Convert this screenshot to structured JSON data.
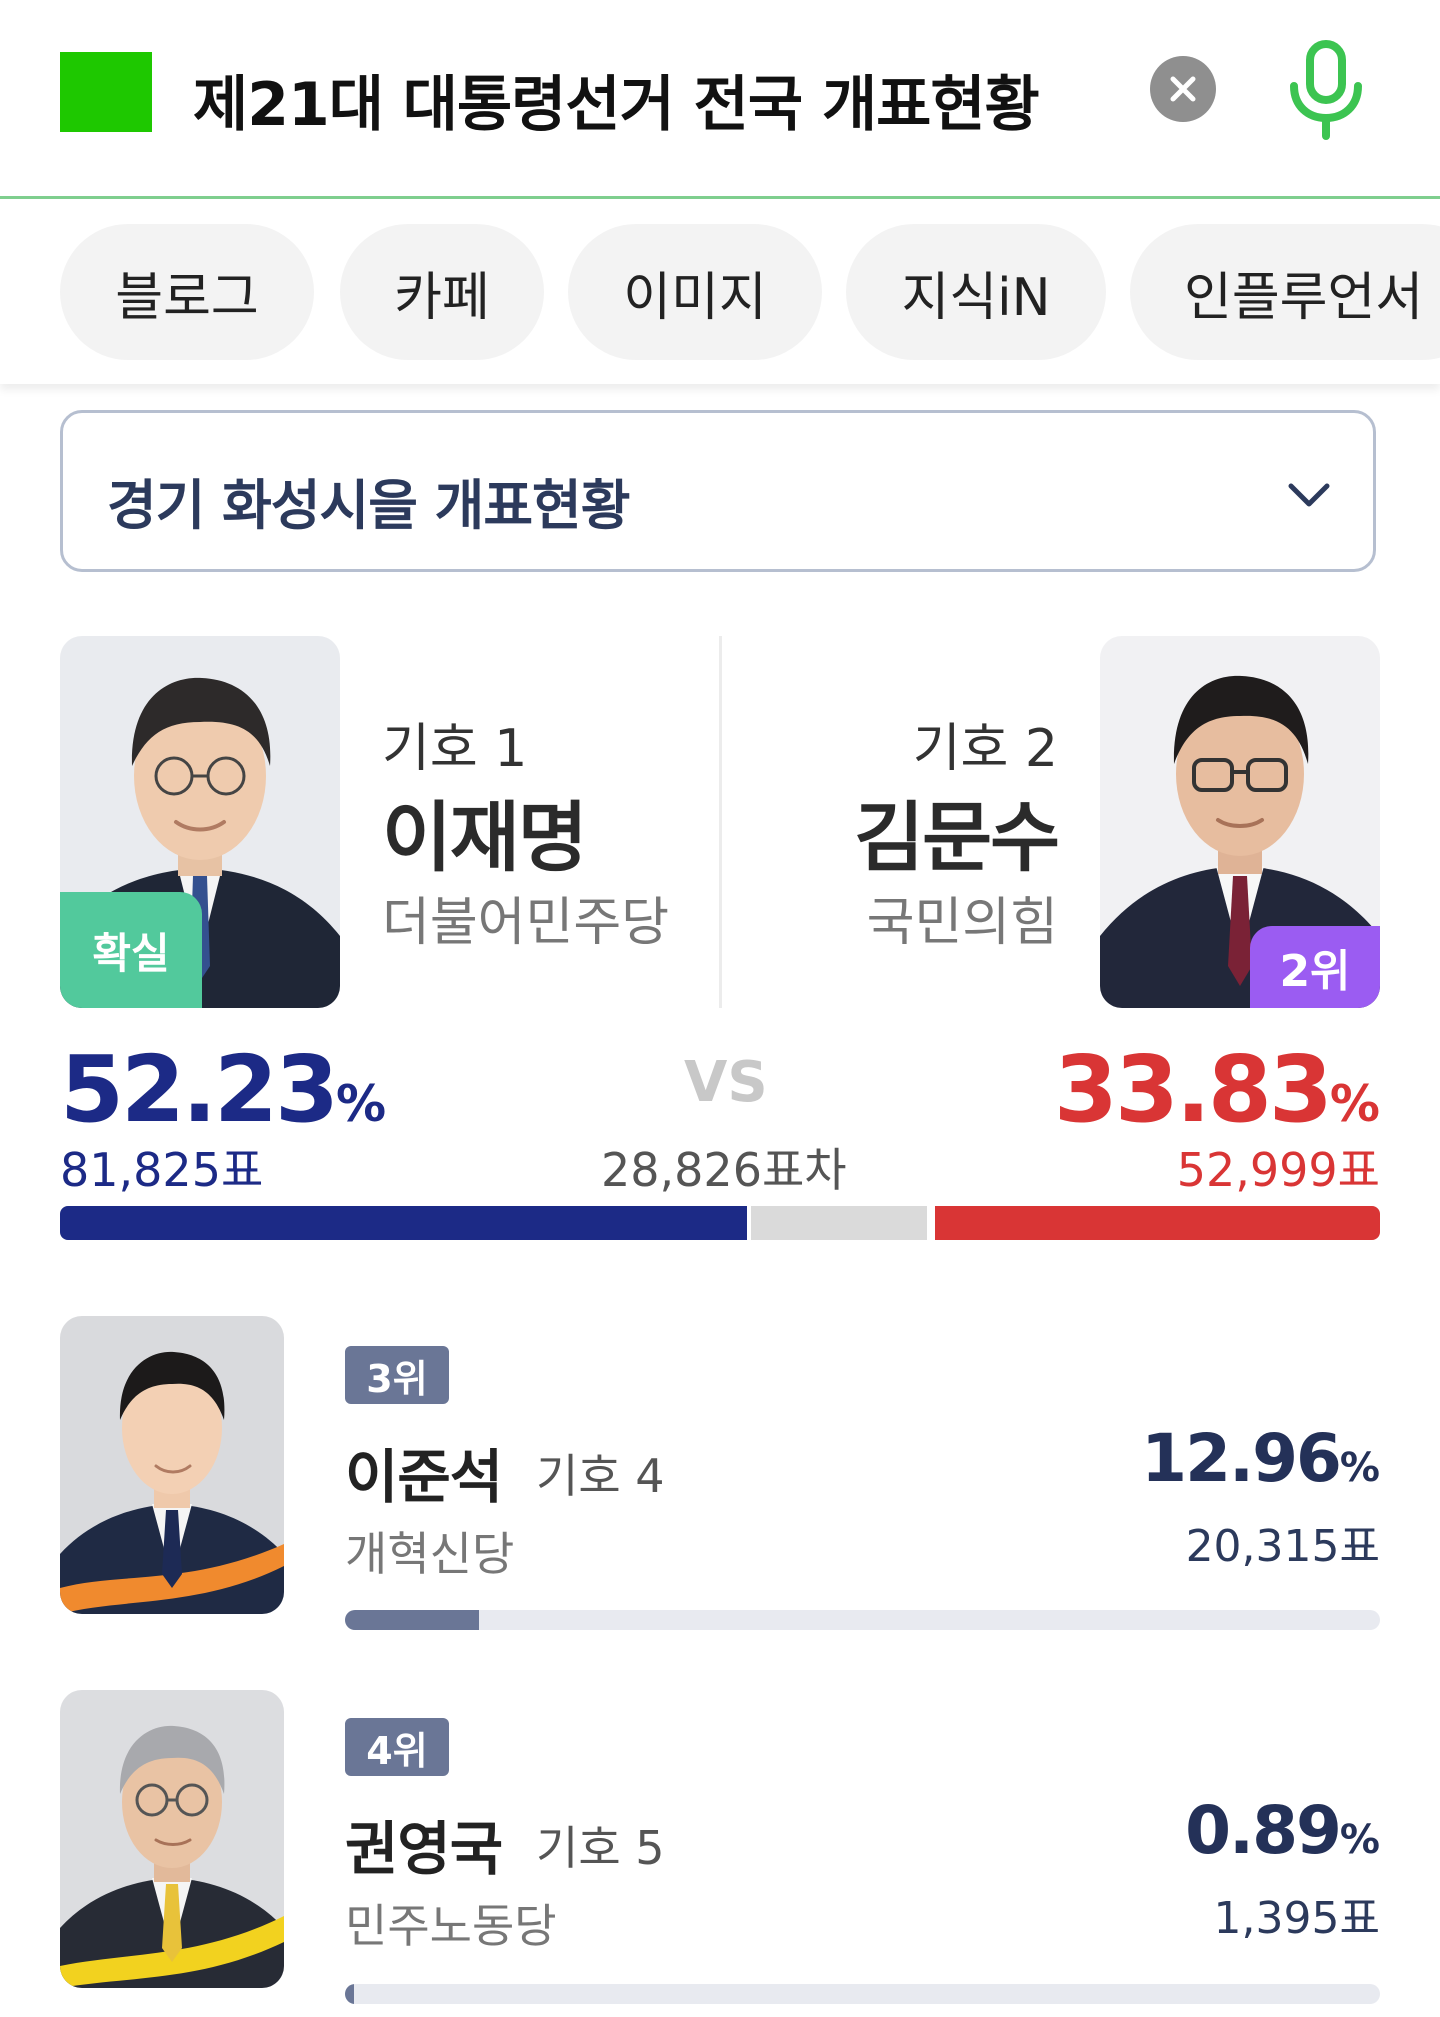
{
  "search": {
    "query": "제21대 대통령선거 전국 개표현황"
  },
  "tabs": [
    "블로그",
    "카페",
    "이미지",
    "지식iN",
    "인플루언서"
  ],
  "district": {
    "label": "경기 화성시을 개표현황"
  },
  "vs": "VS",
  "gap_label": "28,826표차",
  "colors": {
    "first": "#1c2a86",
    "second": "#d93535",
    "confirmed": "#52c99c",
    "rank2": "#9b5cf2",
    "rank_badge": "#6a7696"
  },
  "leaders": [
    {
      "number": "기호 1",
      "name": "이재명",
      "party": "더불어민주당",
      "badge": "확실",
      "pct": "52.23",
      "pct_unit": "%",
      "votes": "81,825표",
      "share": 52.23
    },
    {
      "number": "기호 2",
      "name": "김문수",
      "party": "국민의힘",
      "badge": "2위",
      "pct": "33.83",
      "pct_unit": "%",
      "votes": "52,999표",
      "share": 33.83
    }
  ],
  "others": [
    {
      "rank": "3위",
      "name": "이준석",
      "number": "기호 4",
      "party": "개혁신당",
      "pct": "12.96",
      "pct_unit": "%",
      "votes": "20,315표",
      "share": 12.96
    },
    {
      "rank": "4위",
      "name": "권영국",
      "number": "기호 5",
      "party": "민주노동당",
      "pct": "0.89",
      "pct_unit": "%",
      "votes": "1,395표",
      "share": 0.89
    }
  ]
}
